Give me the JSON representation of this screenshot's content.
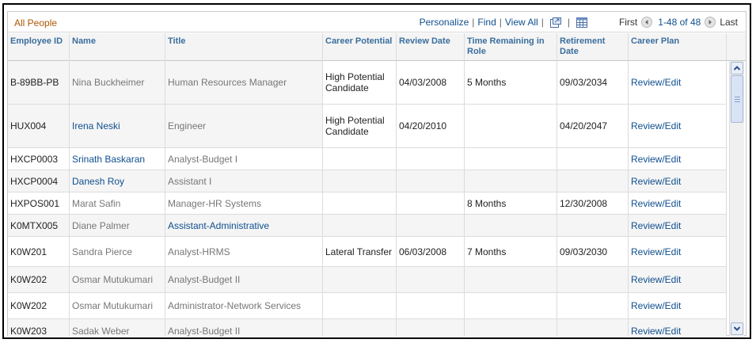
{
  "grid": {
    "title": "All People",
    "nav": {
      "personalize": "Personalize",
      "find": "Find",
      "view_all": "View All",
      "first": "First",
      "range": "1-48 of 48",
      "last": "Last"
    },
    "columns": {
      "employee_id": "Employee ID",
      "name": "Name",
      "title": "Title",
      "career_potential": "Career Potential",
      "review_date": "Review Date",
      "time_remaining": "Time Remaining in Role",
      "retirement_date": "Retirement Date",
      "career_plan": "Career Plan"
    },
    "rows": [
      {
        "id": "B-89BB-PB",
        "name": "Nina Buckheimer",
        "title": "Human Resources Manager",
        "potential": "High Potential Candidate",
        "review": "04/03/2008",
        "remaining": "5 Months",
        "retire": "09/03/2034",
        "plan": "Review/Edit"
      },
      {
        "id": "HUX004",
        "name": "Irena Neski",
        "title": "Engineer",
        "potential": "High Potential Candidate",
        "review": "04/20/2010",
        "remaining": "",
        "retire": "04/20/2047",
        "plan": "Review/Edit"
      },
      {
        "id": "HXCP0003",
        "name": "Srinath Baskaran",
        "title": "Analyst-Budget I",
        "potential": "",
        "review": "",
        "remaining": "",
        "retire": "",
        "plan": "Review/Edit"
      },
      {
        "id": "HXCP0004",
        "name": "Danesh Roy",
        "title": "Assistant I",
        "potential": "",
        "review": "",
        "remaining": "",
        "retire": "",
        "plan": "Review/Edit"
      },
      {
        "id": "HXPOS001",
        "name": "Marat Safin",
        "title": "Manager-HR Systems",
        "potential": "",
        "review": "",
        "remaining": "8 Months",
        "retire": "12/30/2008",
        "plan": "Review/Edit"
      },
      {
        "id": "K0MTX005",
        "name": "Diane Palmer",
        "title": "Assistant-Administrative",
        "potential": "",
        "review": "",
        "remaining": "",
        "retire": "",
        "plan": "Review/Edit"
      },
      {
        "id": "K0W201",
        "name": "Sandra Pierce",
        "title": "Analyst-HRMS",
        "potential": "Lateral Transfer",
        "review": "06/03/2008",
        "remaining": "7 Months",
        "retire": "09/03/2030",
        "plan": "Review/Edit"
      },
      {
        "id": "K0W202",
        "name": "Osmar Mutukumari",
        "title": "Analyst-Budget II",
        "potential": "",
        "review": "",
        "remaining": "",
        "retire": "",
        "plan": "Review/Edit"
      },
      {
        "id": "K0W202",
        "name": "Osmar Mutukumari",
        "title": "Administrator-Network Services",
        "potential": "",
        "review": "",
        "remaining": "",
        "retire": "",
        "plan": "Review/Edit"
      },
      {
        "id": "K0W203",
        "name": "Sadak Weber",
        "title": "Analyst-Budget II",
        "potential": "",
        "review": "",
        "remaining": "",
        "retire": "",
        "plan": "Review/Edit"
      }
    ]
  },
  "icons": {
    "zoom": "new-window-icon",
    "download": "spreadsheet-icon",
    "prev": "arrow-left-icon",
    "next": "arrow-right-icon",
    "scroll_up": "chevron-up-icon",
    "scroll_down": "chevron-down-icon"
  },
  "colors": {
    "title": "#ad5700",
    "link": "#0f4f8f",
    "header_text": "#3a6e9e",
    "muted_text": "#777777"
  }
}
